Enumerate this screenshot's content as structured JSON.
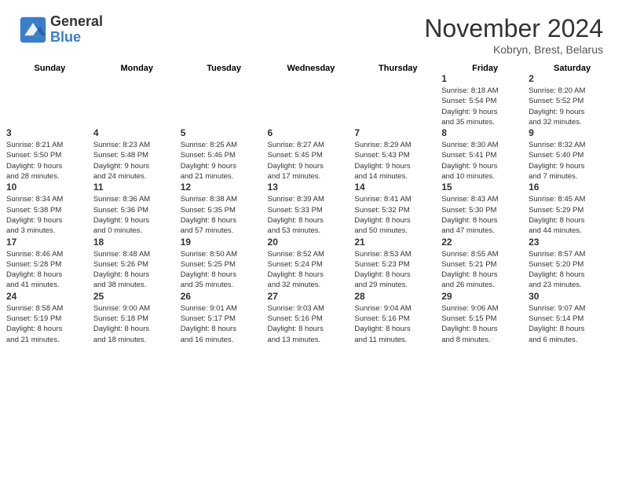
{
  "header": {
    "logo_general": "General",
    "logo_blue": "Blue",
    "month_title": "November 2024",
    "location": "Kobryn, Brest, Belarus"
  },
  "days_of_week": [
    "Sunday",
    "Monday",
    "Tuesday",
    "Wednesday",
    "Thursday",
    "Friday",
    "Saturday"
  ],
  "weeks": [
    [
      {
        "day": "",
        "info": ""
      },
      {
        "day": "",
        "info": ""
      },
      {
        "day": "",
        "info": ""
      },
      {
        "day": "",
        "info": ""
      },
      {
        "day": "",
        "info": ""
      },
      {
        "day": "1",
        "info": "Sunrise: 8:18 AM\nSunset: 5:54 PM\nDaylight: 9 hours\nand 35 minutes."
      },
      {
        "day": "2",
        "info": "Sunrise: 8:20 AM\nSunset: 5:52 PM\nDaylight: 9 hours\nand 32 minutes."
      }
    ],
    [
      {
        "day": "3",
        "info": "Sunrise: 8:21 AM\nSunset: 5:50 PM\nDaylight: 9 hours\nand 28 minutes."
      },
      {
        "day": "4",
        "info": "Sunrise: 8:23 AM\nSunset: 5:48 PM\nDaylight: 9 hours\nand 24 minutes."
      },
      {
        "day": "5",
        "info": "Sunrise: 8:25 AM\nSunset: 5:46 PM\nDaylight: 9 hours\nand 21 minutes."
      },
      {
        "day": "6",
        "info": "Sunrise: 8:27 AM\nSunset: 5:45 PM\nDaylight: 9 hours\nand 17 minutes."
      },
      {
        "day": "7",
        "info": "Sunrise: 8:29 AM\nSunset: 5:43 PM\nDaylight: 9 hours\nand 14 minutes."
      },
      {
        "day": "8",
        "info": "Sunrise: 8:30 AM\nSunset: 5:41 PM\nDaylight: 9 hours\nand 10 minutes."
      },
      {
        "day": "9",
        "info": "Sunrise: 8:32 AM\nSunset: 5:40 PM\nDaylight: 9 hours\nand 7 minutes."
      }
    ],
    [
      {
        "day": "10",
        "info": "Sunrise: 8:34 AM\nSunset: 5:38 PM\nDaylight: 9 hours\nand 3 minutes."
      },
      {
        "day": "11",
        "info": "Sunrise: 8:36 AM\nSunset: 5:36 PM\nDaylight: 9 hours\nand 0 minutes."
      },
      {
        "day": "12",
        "info": "Sunrise: 8:38 AM\nSunset: 5:35 PM\nDaylight: 8 hours\nand 57 minutes."
      },
      {
        "day": "13",
        "info": "Sunrise: 8:39 AM\nSunset: 5:33 PM\nDaylight: 8 hours\nand 53 minutes."
      },
      {
        "day": "14",
        "info": "Sunrise: 8:41 AM\nSunset: 5:32 PM\nDaylight: 8 hours\nand 50 minutes."
      },
      {
        "day": "15",
        "info": "Sunrise: 8:43 AM\nSunset: 5:30 PM\nDaylight: 8 hours\nand 47 minutes."
      },
      {
        "day": "16",
        "info": "Sunrise: 8:45 AM\nSunset: 5:29 PM\nDaylight: 8 hours\nand 44 minutes."
      }
    ],
    [
      {
        "day": "17",
        "info": "Sunrise: 8:46 AM\nSunset: 5:28 PM\nDaylight: 8 hours\nand 41 minutes."
      },
      {
        "day": "18",
        "info": "Sunrise: 8:48 AM\nSunset: 5:26 PM\nDaylight: 8 hours\nand 38 minutes."
      },
      {
        "day": "19",
        "info": "Sunrise: 8:50 AM\nSunset: 5:25 PM\nDaylight: 8 hours\nand 35 minutes."
      },
      {
        "day": "20",
        "info": "Sunrise: 8:52 AM\nSunset: 5:24 PM\nDaylight: 8 hours\nand 32 minutes."
      },
      {
        "day": "21",
        "info": "Sunrise: 8:53 AM\nSunset: 5:23 PM\nDaylight: 8 hours\nand 29 minutes."
      },
      {
        "day": "22",
        "info": "Sunrise: 8:55 AM\nSunset: 5:21 PM\nDaylight: 8 hours\nand 26 minutes."
      },
      {
        "day": "23",
        "info": "Sunrise: 8:57 AM\nSunset: 5:20 PM\nDaylight: 8 hours\nand 23 minutes."
      }
    ],
    [
      {
        "day": "24",
        "info": "Sunrise: 8:58 AM\nSunset: 5:19 PM\nDaylight: 8 hours\nand 21 minutes."
      },
      {
        "day": "25",
        "info": "Sunrise: 9:00 AM\nSunset: 5:18 PM\nDaylight: 8 hours\nand 18 minutes."
      },
      {
        "day": "26",
        "info": "Sunrise: 9:01 AM\nSunset: 5:17 PM\nDaylight: 8 hours\nand 16 minutes."
      },
      {
        "day": "27",
        "info": "Sunrise: 9:03 AM\nSunset: 5:16 PM\nDaylight: 8 hours\nand 13 minutes."
      },
      {
        "day": "28",
        "info": "Sunrise: 9:04 AM\nSunset: 5:16 PM\nDaylight: 8 hours\nand 11 minutes."
      },
      {
        "day": "29",
        "info": "Sunrise: 9:06 AM\nSunset: 5:15 PM\nDaylight: 8 hours\nand 8 minutes."
      },
      {
        "day": "30",
        "info": "Sunrise: 9:07 AM\nSunset: 5:14 PM\nDaylight: 8 hours\nand 6 minutes."
      }
    ]
  ]
}
